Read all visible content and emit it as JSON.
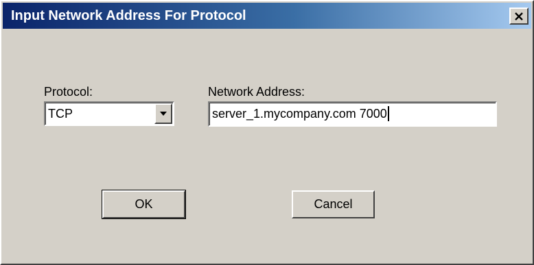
{
  "window": {
    "title": "Input Network Address For Protocol",
    "close_icon": "close-icon"
  },
  "form": {
    "protocol_label": "Protocol:",
    "protocol_value": "TCP",
    "address_label": "Network Address:",
    "address_value": "server_1.mycompany.com 7000"
  },
  "buttons": {
    "ok_label": "OK",
    "cancel_label": "Cancel"
  },
  "colors": {
    "dialog_bg": "#d4d0c8",
    "title_gradient_start": "#0a246a",
    "title_gradient_end": "#a6caf0",
    "title_text": "#ffffff"
  }
}
